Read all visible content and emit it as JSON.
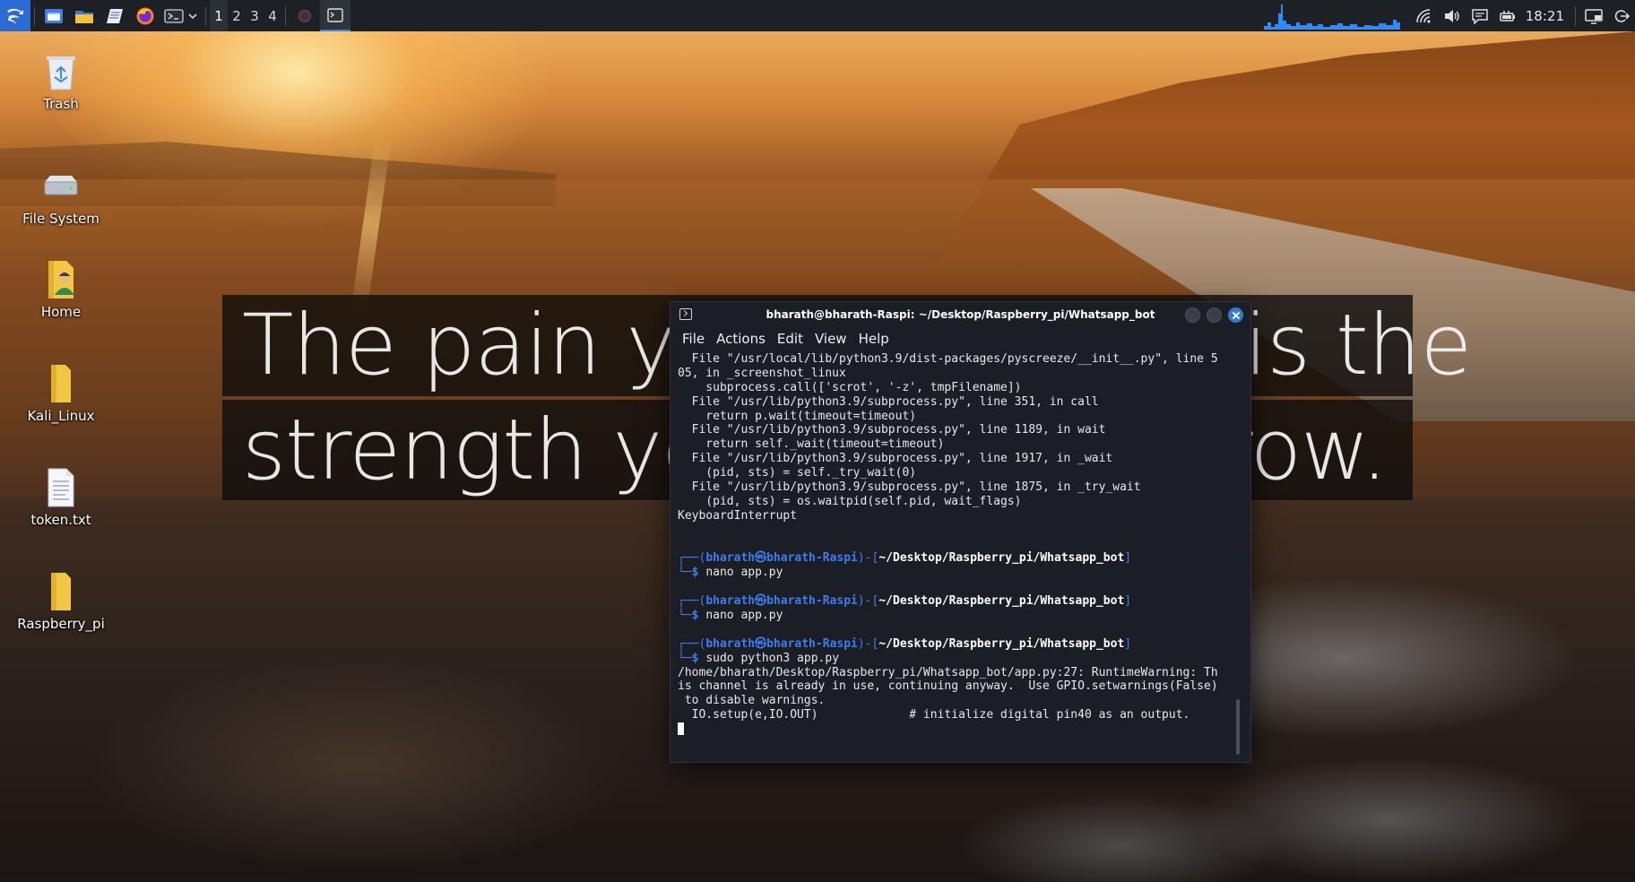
{
  "panel": {
    "workspaces": [
      "1",
      "2",
      "3",
      "4"
    ],
    "active_workspace": "1",
    "clock": "18:21",
    "icons": {
      "launcher": "kali-menu-icon",
      "files": "file-manager-icon",
      "folder": "folder-icon",
      "editor": "text-editor-icon",
      "browser": "firefox-icon",
      "terminal": "terminal-icon",
      "network": "wifi-icon",
      "volume": "volume-icon",
      "notifications": "notifications-icon",
      "power": "battery-power-icon",
      "display": "display-icon",
      "logout": "logout-icon"
    },
    "cpu_graph_color": "#2b8cff"
  },
  "desktop": {
    "icons": [
      {
        "label": "Trash",
        "icon": "trash-icon"
      },
      {
        "label": "File System",
        "icon": "drive-icon"
      },
      {
        "label": "Home",
        "icon": "home-folder-icon"
      },
      {
        "label": "Kali_Linux",
        "icon": "folder-icon"
      },
      {
        "label": "token.txt",
        "icon": "text-file-icon"
      },
      {
        "label": "Raspberry_pi",
        "icon": "folder-icon"
      }
    ]
  },
  "wallpaper_quote": {
    "line1": "The pain you feel today is the",
    "line2": "strength you feel tomorrow."
  },
  "terminal": {
    "title": "bharath@bharath-Raspi: ~/Desktop/Raspberry_pi/Whatsapp_bot",
    "menu": [
      "File",
      "Actions",
      "Edit",
      "View",
      "Help"
    ],
    "accent": "#3c7ef0",
    "close_color": "#2f7bd8",
    "traceback": [
      "  File \"/usr/local/lib/python3.9/dist-packages/pyscreeze/__init__.py\", line 5",
      "05, in _screenshot_linux",
      "    subprocess.call(['scrot', '-z', tmpFilename])",
      "  File \"/usr/lib/python3.9/subprocess.py\", line 351, in call",
      "    return p.wait(timeout=timeout)",
      "  File \"/usr/lib/python3.9/subprocess.py\", line 1189, in wait",
      "    return self._wait(timeout=timeout)",
      "  File \"/usr/lib/python3.9/subprocess.py\", line 1917, in _wait",
      "    (pid, sts) = self._try_wait(0)",
      "  File \"/usr/lib/python3.9/subprocess.py\", line 1875, in _try_wait",
      "    (pid, sts) = os.waitpid(self.pid, wait_flags)",
      "KeyboardInterrupt"
    ],
    "prompt": {
      "user_host": "bharath㉿bharath-Raspi",
      "path": "~/Desktop/Raspberry_pi/Whatsapp_bot"
    },
    "commands": [
      {
        "cmd": "nano app.py"
      },
      {
        "cmd": "nano app.py"
      },
      {
        "cmd": "sudo python3 app.py"
      }
    ],
    "output": [
      "/home/bharath/Desktop/Raspberry_pi/Whatsapp_bot/app.py:27: RuntimeWarning: Th",
      "is channel is already in use, continuing anyway.  Use GPIO.setwarnings(False)",
      " to disable warnings.",
      "  IO.setup(e,IO.OUT)             # initialize digital pin40 as an output."
    ]
  }
}
